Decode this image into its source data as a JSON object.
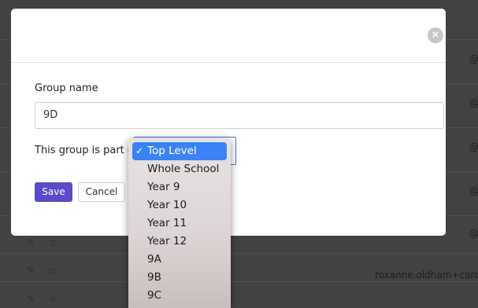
{
  "background": {
    "emails": [
      "@",
      "@",
      "@",
      "@",
      "@",
      "roxanne.oldham+caro"
    ]
  },
  "modal": {
    "close_icon": "×",
    "group_name_label": "Group name",
    "group_name_value": "9D",
    "parent_label": "This group is part of",
    "save_label": "Save",
    "cancel_label": "Cancel"
  },
  "dropdown": {
    "check_mark": "✓",
    "selected": "Top Level",
    "options": [
      "Top Level",
      "Whole School",
      "Year 9",
      "Year 10",
      "Year 11",
      "Year 12",
      "9A",
      "9B",
      "9C"
    ]
  },
  "colors": {
    "primary": "#5a4bc7",
    "select_highlight": "#3b82f6"
  }
}
